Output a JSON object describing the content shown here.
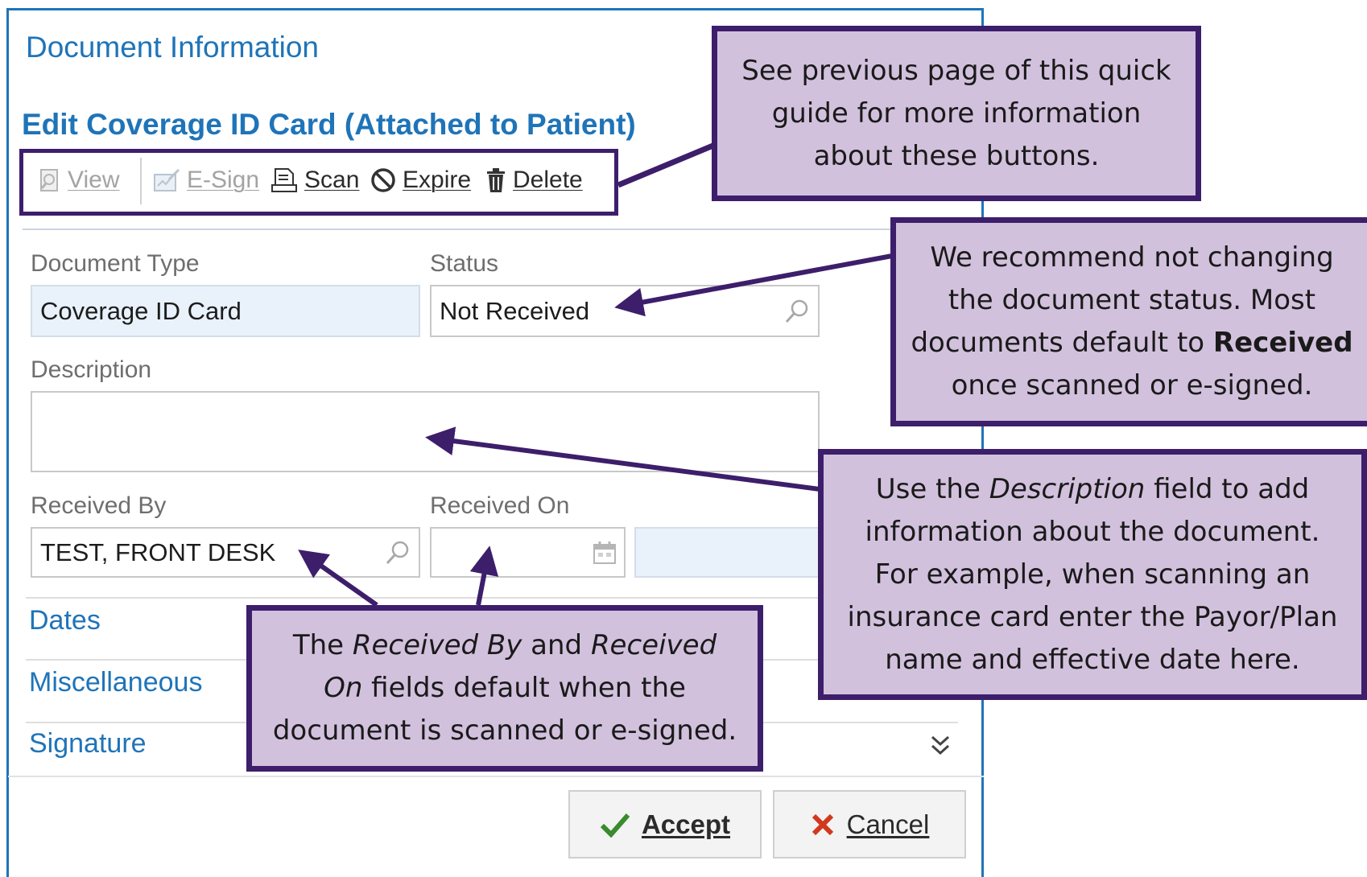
{
  "dialog": {
    "title": "Document Information",
    "subtitle": "Edit Coverage ID Card (Attached to Patient)"
  },
  "toolbar": {
    "view": "View",
    "esign": "E-Sign",
    "scan": "Scan",
    "expire": "Expire",
    "delete": "Delete"
  },
  "fields": {
    "document_type_label": "Document Type",
    "document_type_value": "Coverage ID Card",
    "status_label": "Status",
    "status_value": "Not Received",
    "description_label": "Description",
    "description_value": "",
    "received_by_label": "Received By",
    "received_by_value": "TEST, FRONT DESK",
    "received_on_label": "Received On",
    "received_on_value": ""
  },
  "sections": {
    "dates": "Dates",
    "miscellaneous": "Miscellaneous",
    "signature": "Signature"
  },
  "buttons": {
    "accept": "Accept",
    "cancel": "Cancel"
  },
  "callouts": {
    "toolbar_note": [
      "See previous page of this quick",
      "guide for more information",
      "about these buttons."
    ],
    "status_note": {
      "line1": "We recommend not changing",
      "line2": "the document status.  Most",
      "line3_pre": "documents default to ",
      "line3_bold": "Received",
      "line4": "once scanned or e-signed."
    },
    "description_note": {
      "line1_pre": "Use the ",
      "line1_em": "Description",
      "line1_post": " field to add",
      "line2": "information about the document.",
      "line3": "For example, when scanning an",
      "line4": "insurance card enter the Payor/Plan",
      "line5": "name and effective date here."
    },
    "received_note": {
      "line1_pre": "The ",
      "line1_em1": "Received By",
      "line1_mid": " and ",
      "line1_em2": "Received",
      "line2_em": "On",
      "line2_post": " fields default when the",
      "line3": "document is scanned or e-signed."
    }
  },
  "colors": {
    "accent_blue": "#1f74b8",
    "callout_fill": "#d2c1dd",
    "callout_border": "#3d1e6b",
    "accept_check": "#3a8a2e",
    "cancel_x": "#d0391e"
  },
  "icons": [
    "view-icon",
    "esign-icon",
    "scan-icon",
    "expire-icon",
    "delete-icon",
    "search-icon",
    "calendar-icon",
    "expand-chevrons-icon",
    "checkmark-icon",
    "x-icon"
  ]
}
